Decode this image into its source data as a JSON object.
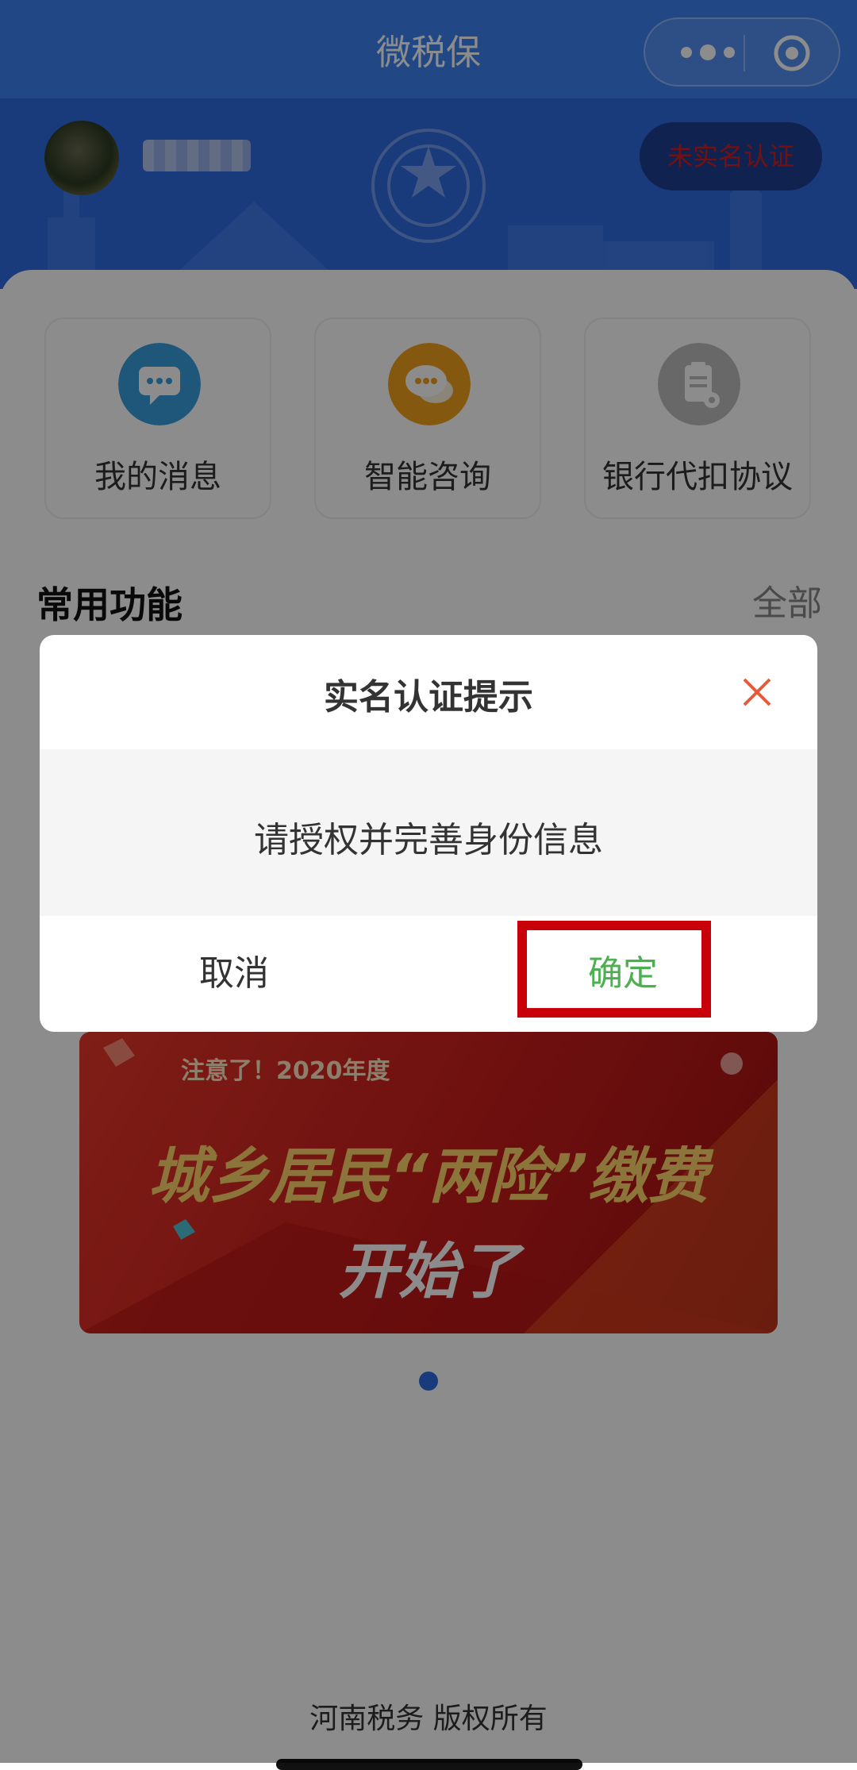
{
  "app": {
    "title": "微税保"
  },
  "header": {
    "auth_badge": "未实名认证"
  },
  "quick_cards": [
    {
      "label": "我的消息",
      "icon": "message-bubble-icon",
      "color": "#3a9fe0"
    },
    {
      "label": "智能咨询",
      "icon": "chat-bubbles-icon",
      "color": "#f2a01e"
    },
    {
      "label": "银行代扣协议",
      "icon": "clipboard-gear-icon",
      "color": "#bdbdbd"
    }
  ],
  "section": {
    "title": "常用功能",
    "all": "全部"
  },
  "banner": {
    "line1": "注意了！2020年度",
    "line2": "城乡居民“两险”缴费",
    "line3": "开始了"
  },
  "footer": {
    "text": "河南税务   版权所有"
  },
  "dialog": {
    "title": "实名认证提示",
    "message": "请授权并完善身份信息",
    "cancel": "取消",
    "confirm": "确定"
  },
  "colors": {
    "primary": "#3d82f2",
    "confirm": "#4caf50",
    "highlight": "#c8000a",
    "close": "#e65a3c"
  }
}
